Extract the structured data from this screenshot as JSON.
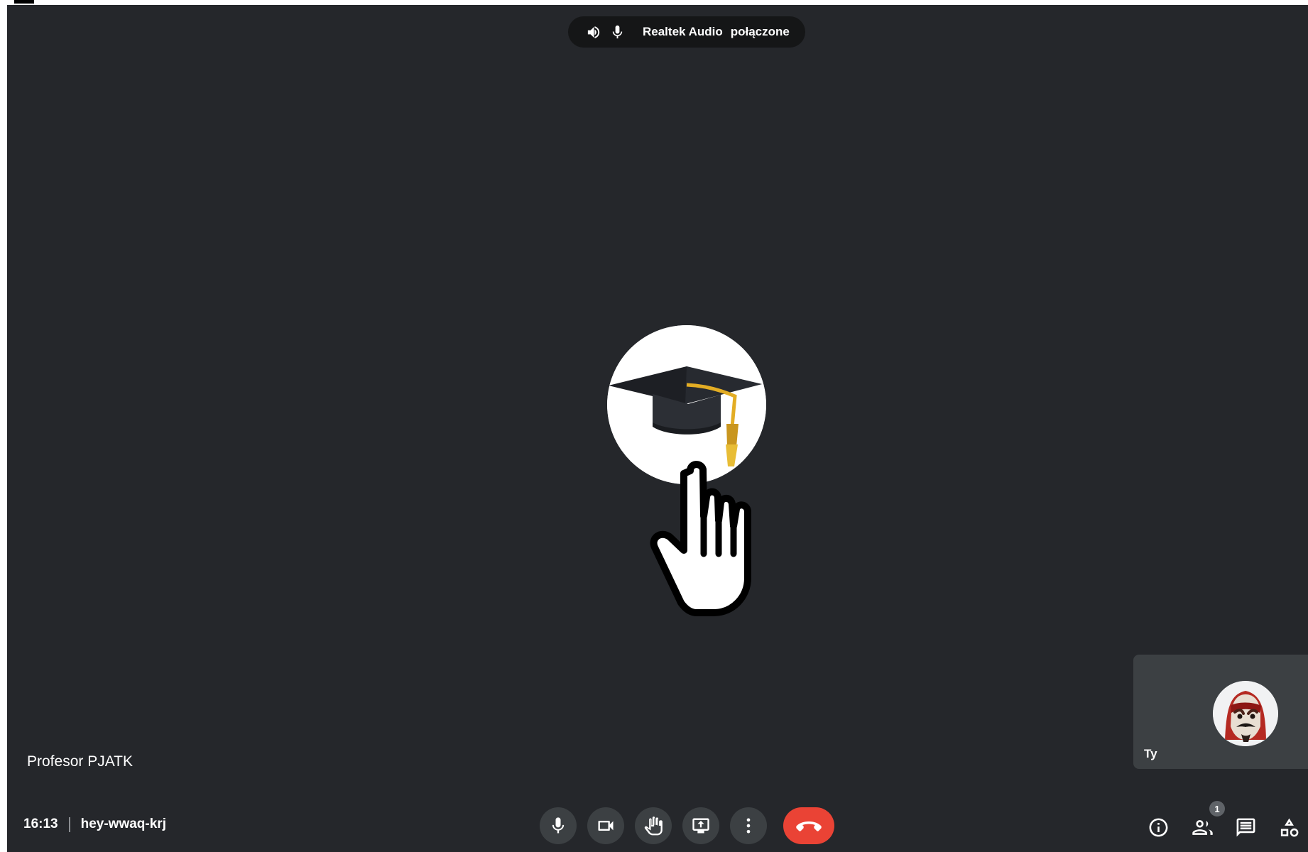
{
  "audio": {
    "device": "Realtek Audio",
    "status": "połączone",
    "speaker_icon": "speaker-icon",
    "microphone_icon": "microphone-icon"
  },
  "main_participant": {
    "name": "Profesor PJATK",
    "avatar": "graduation-cap"
  },
  "self_view": {
    "label": "Ty",
    "avatar": "mask-avatar"
  },
  "meeting": {
    "time": "16:13",
    "code": "hey-wwaq-krj"
  },
  "controls": {
    "microphone": "microphone-icon",
    "camera": "camera-icon",
    "raise_hand": "hand-icon",
    "present": "present-screen-icon",
    "more": "more-options-icon",
    "leave": "end-call-icon"
  },
  "side_panel": {
    "details": "info-icon",
    "people": "people-icon",
    "people_count": "1",
    "chat": "chat-icon",
    "activities": "activities-icon"
  },
  "colors": {
    "meeting_background": "#25272b",
    "control_background": "#3c4043",
    "end_call": "#ea4335",
    "text": "#ffffff"
  }
}
